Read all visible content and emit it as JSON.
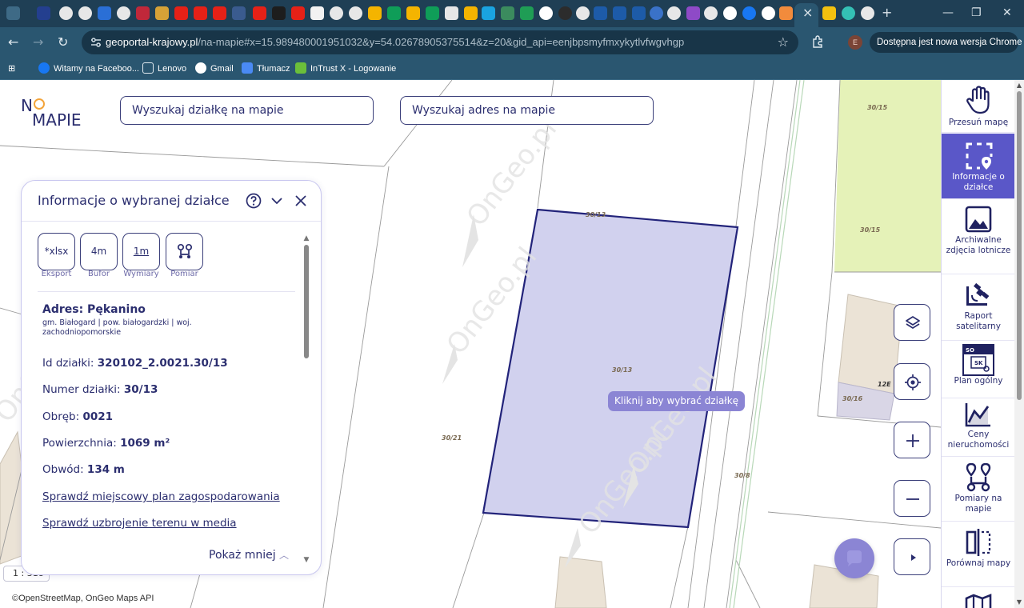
{
  "browser": {
    "url_host": "geoportal-krajowy.pl",
    "url_path": "/na-mapie#x=15.989480001951032&y=54.02678905375514&z=20&gid_api=eenjbpsmyfmxykytlvfwgvhgp",
    "update_text": "Dostępna jest nowa wersja Chrome",
    "profile_initial": "E",
    "bookmarks": [
      "Witamy na Faceboo...",
      "Lenovo",
      "Gmail",
      "Tłumacz",
      "InTrust X - Logowanie"
    ]
  },
  "logo": {
    "line1": "N",
    "line2": "MAPIE"
  },
  "search": {
    "parcel_placeholder": "Wyszukaj działkę na mapie",
    "address_placeholder": "Wyszukaj adres na mapie"
  },
  "panel": {
    "title": "Informacje o wybranej działce",
    "tools": [
      {
        "icon": "*xlsx",
        "label": "Eksport"
      },
      {
        "icon": "4m",
        "label": "Bufor"
      },
      {
        "icon": "1m",
        "label": "Wymiary"
      },
      {
        "icon": "",
        "label": "Pomiar"
      }
    ],
    "address_title": "Adres: Pękanino",
    "address_sub": "gm. Białogard | pow. białogardzki | woj. zachodniopomorskie",
    "fields": [
      {
        "label": "Id działki:",
        "value": "320102_2.0021.30/13"
      },
      {
        "label": "Numer działki:",
        "value": "30/13"
      },
      {
        "label": "Obręb:",
        "value": "0021"
      },
      {
        "label": "Powierzchnia:",
        "value": "1069 m²"
      },
      {
        "label": "Obwód:",
        "value": "134 m"
      }
    ],
    "link_plan": "Sprawdź miejscowy plan zagospodarowania",
    "link_media": "Sprawdź uzbrojenie terenu w media",
    "show_less": "Pokaż mniej"
  },
  "map": {
    "hint": "Kliknij aby wybrać działkę",
    "scale": "1 : 318",
    "attribution": "©OpenStreetMap, OnGeo Maps API",
    "watermark": "OnGeo.pl",
    "parcel_labels": [
      "30/15",
      "30/15",
      "30/13",
      "30/13",
      "30/21",
      "30/16",
      "30/8",
      "12E"
    ],
    "colors": {
      "parcel_fill": "#cfcfed",
      "parcel_stroke": "#22237a",
      "green_area": "#e5f2b8",
      "building": "#ebe3d6"
    }
  },
  "sidebar": {
    "items": [
      {
        "label": "Przesuń mapę",
        "icon": "hand-icon",
        "active": false
      },
      {
        "label": "Informacje o działce",
        "icon": "parcel-info-icon",
        "active": true
      },
      {
        "label": "Archiwalne zdjęcia lotnicze",
        "icon": "image-icon",
        "active": false
      },
      {
        "label": "Raport satelitarny",
        "icon": "satellite-icon",
        "active": false
      },
      {
        "label": "Plan ogólny",
        "icon": "plan-icon",
        "active": false
      },
      {
        "label": "Ceny nieruchomości",
        "icon": "chart-icon",
        "active": false
      },
      {
        "label": "Pomiary na mapie",
        "icon": "measure-icon",
        "active": false
      },
      {
        "label": "Porównaj mapy",
        "icon": "compare-icon",
        "active": false
      },
      {
        "label": "",
        "icon": "map-icon",
        "active": false
      }
    ],
    "plan_badge_top": "SO",
    "plan_badge_mid": "SK"
  }
}
